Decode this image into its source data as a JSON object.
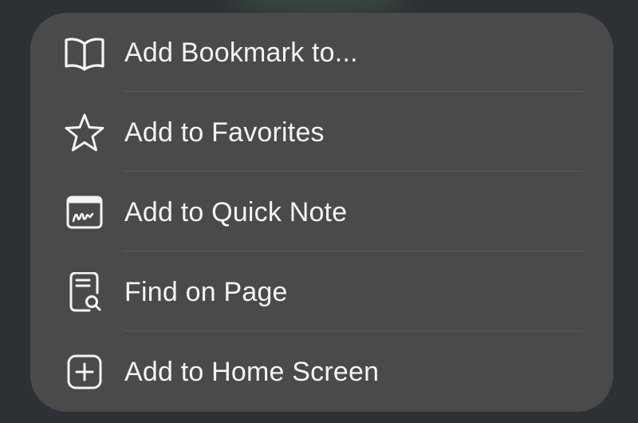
{
  "menu": {
    "items": [
      {
        "label": "Add Bookmark to...",
        "icon": "book-icon"
      },
      {
        "label": "Add to Favorites",
        "icon": "star-icon"
      },
      {
        "label": "Add to Quick Note",
        "icon": "quick-note-icon"
      },
      {
        "label": "Find on Page",
        "icon": "find-on-page-icon"
      },
      {
        "label": "Add to Home Screen",
        "icon": "add-square-icon"
      }
    ]
  },
  "colors": {
    "background": "#2d3136",
    "menu_background": "#4a4a4b",
    "divider": "#5b5b5c",
    "text": "#f4f4f4"
  }
}
